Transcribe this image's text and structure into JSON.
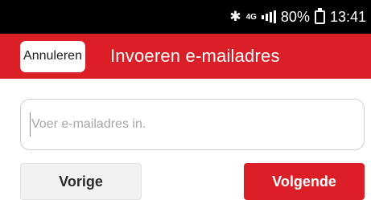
{
  "status_bar": {
    "network_label": "4G",
    "battery_percent": "80%",
    "time": "13:41",
    "icons": [
      "bluetooth-icon",
      "network-4g-icon",
      "signal-icon",
      "battery-charging-icon"
    ]
  },
  "header": {
    "cancel_label": "Annuleren",
    "title": "Invoeren e-mailadres",
    "background_color": "#dc1f26"
  },
  "form": {
    "email_placeholder": "Voer e-mailadres in.",
    "email_value": ""
  },
  "actions": {
    "prev_label": "Vorige",
    "next_label": "Volgende",
    "next_color": "#dc1f26"
  }
}
